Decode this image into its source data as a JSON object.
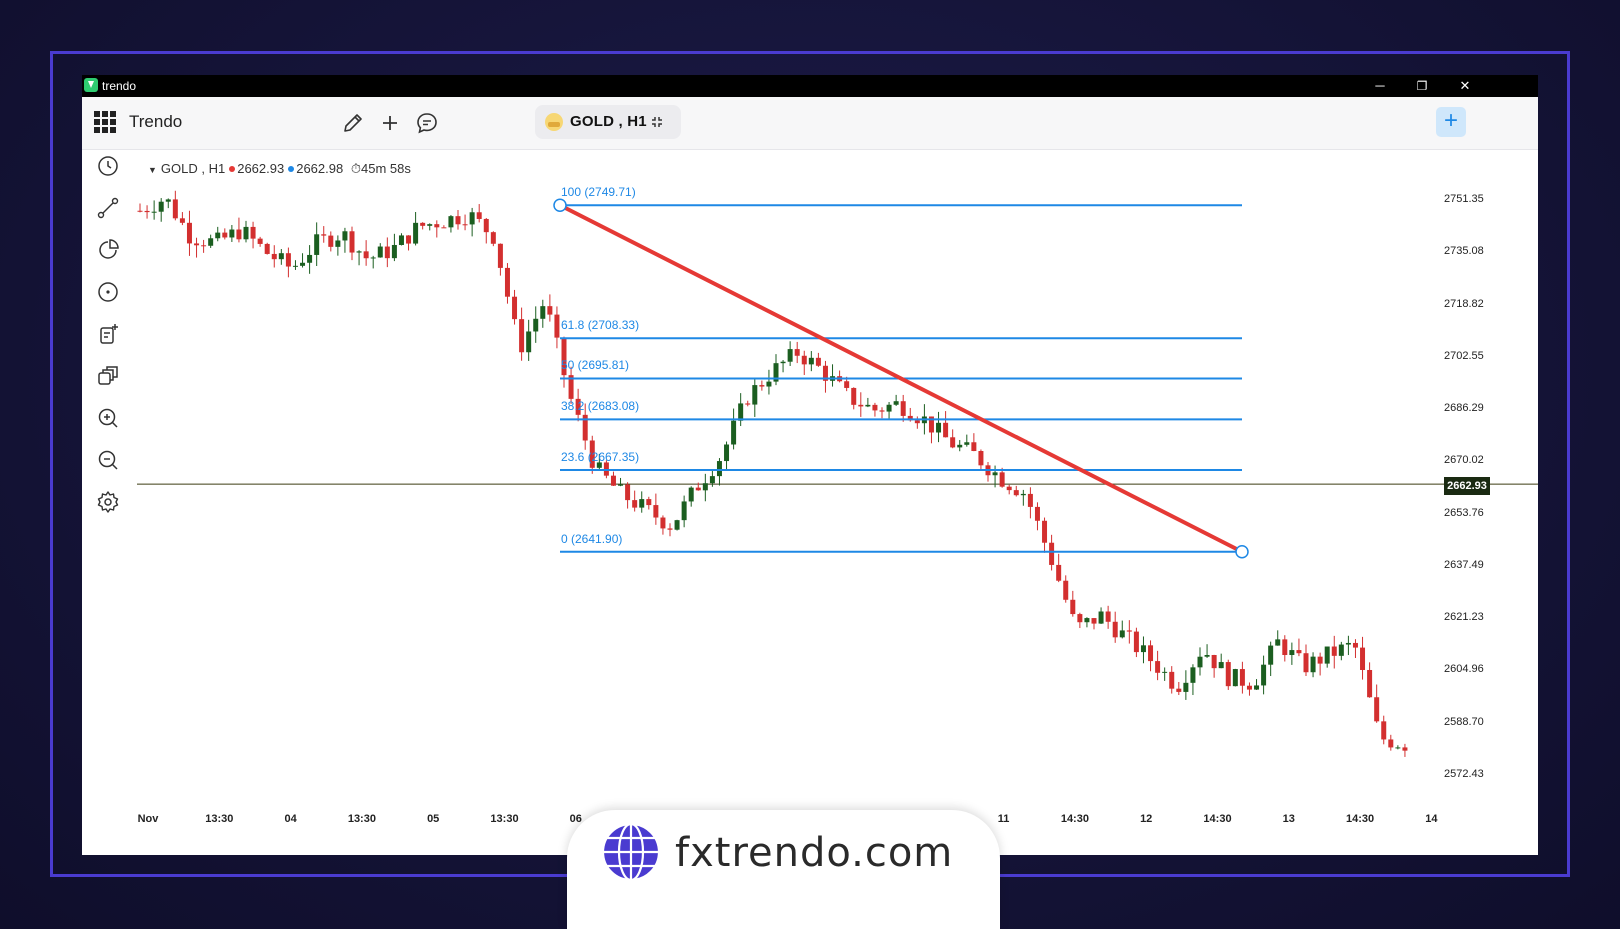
{
  "window": {
    "title": "trendo",
    "controls": [
      "minimize",
      "restore",
      "close"
    ],
    "minimize_glyph": "─",
    "restore_glyph": "❐",
    "close_glyph": "✕"
  },
  "toolbar": {
    "app_name": "Trendo",
    "icons": [
      "grid-icon",
      "pencil-icon",
      "plus-icon",
      "chat-icon"
    ],
    "symbol_pill": "GOLD , H1",
    "add_button": "+"
  },
  "sidebar": {
    "icons": [
      "clock-icon",
      "trendline-tool-icon",
      "pie-tool-icon",
      "circle-tool-icon",
      "note-add-icon",
      "layers-icon",
      "zoom-in-icon",
      "zoom-out-icon",
      "settings-icon"
    ]
  },
  "legend": {
    "symbol": "GOLD , H1",
    "bid": "2662.93",
    "ask": "2662.98",
    "timer": "45m 58s",
    "bid_color": "#e53935",
    "ask_color": "#1e88e5"
  },
  "chart_data": {
    "type": "candlestick",
    "symbol": "GOLD , H1",
    "current_price": "2662.93",
    "y_tick_labels": [
      "2751.35",
      "2735.08",
      "2718.82",
      "2702.55",
      "2686.29",
      "2670.02",
      "2653.76",
      "2637.49",
      "2621.23",
      "2604.96",
      "2588.70",
      "2572.43"
    ],
    "ylim": [
      2567,
      2760
    ],
    "x_tick_labels": [
      "Nov",
      "13:30",
      "04",
      "13:30",
      "05",
      "13:30",
      "06",
      "11",
      "14:30",
      "12",
      "14:30",
      "13",
      "14:30",
      "14"
    ],
    "price_path": [
      2748,
      2752,
      2740,
      2738,
      2742,
      2735,
      2730,
      2738,
      2741,
      2733,
      2736,
      2743,
      2745,
      2747,
      2740,
      2705,
      2720,
      2690,
      2668,
      2660,
      2655,
      2650,
      2662,
      2672,
      2690,
      2698,
      2704,
      2698,
      2690,
      2686,
      2688,
      2683,
      2676,
      2672,
      2665,
      2660,
      2640,
      2618,
      2622,
      2615,
      2608,
      2600,
      2612,
      2603,
      2601,
      2614,
      2606,
      2610,
      2613,
      2584,
      2582
    ],
    "fibonacci": {
      "levels": [
        {
          "label": "100 (2749.71)",
          "price": 2749.71
        },
        {
          "label": "61.8 (2708.33)",
          "price": 2708.33
        },
        {
          "label": "50 (2695.81)",
          "price": 2695.81
        },
        {
          "label": "38.2 (2683.08)",
          "price": 2683.08
        },
        {
          "label": "23.6 (2667.35)",
          "price": 2667.35
        },
        {
          "label": "0 (2641.90)",
          "price": 2641.9
        }
      ],
      "color": "#1e88e5"
    },
    "trendline": {
      "from_price": 2749.71,
      "to_price": 2641.9,
      "color": "#e53935"
    },
    "colors": {
      "up": "#1b5e20",
      "down": "#d32f2f",
      "price_line": "#3b3b10"
    }
  },
  "brand": {
    "text": "fxtrendo.com",
    "color": "#4a3bd0"
  }
}
